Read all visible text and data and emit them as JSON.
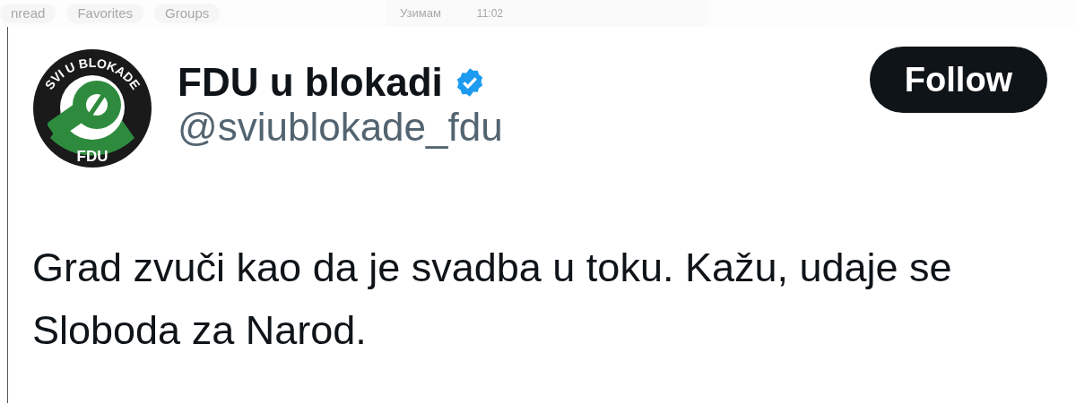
{
  "background_tabs": [
    {
      "label": "nread"
    },
    {
      "label": "Favorites"
    },
    {
      "label": "Groups"
    }
  ],
  "background_message": {
    "text": "Узимам",
    "time": "11:02"
  },
  "tweet": {
    "avatar": {
      "top_text": "SVI U BLOKADE",
      "bottom_text": "FDU"
    },
    "name": "FDU u blokadi",
    "verified": true,
    "handle": "@sviublokade_fdu",
    "follow_button": "Follow",
    "text": "Grad zvuči kao da je svadba u toku. Kažu, udaje se Sloboda za Narod."
  }
}
